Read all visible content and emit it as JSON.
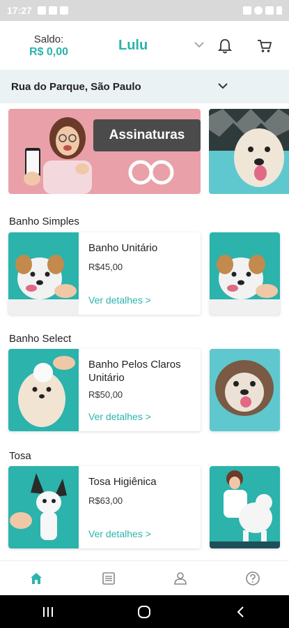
{
  "status_bar": {
    "time": "17:27",
    "icons_left": [
      "image-icon",
      "facebook-icon",
      "play-icon"
    ],
    "icons_right": [
      "mute-icon",
      "wifi-icon",
      "signal-icon",
      "battery-icon"
    ]
  },
  "header": {
    "balance_label": "Saldo:",
    "balance_value": "R$ 0,00",
    "pet_name": "Lulu",
    "icons": [
      "chevron-down-icon",
      "bell-icon",
      "cart-icon"
    ]
  },
  "address": {
    "text": "Rua do Parque, São Paulo",
    "icon": "chevron-down-icon"
  },
  "banner": {
    "tag": "Assinaturas",
    "icon": "infinity-icon"
  },
  "sections": [
    {
      "title": "Banho Simples",
      "product": {
        "name": "Banho Unitário",
        "price": "R$45,00",
        "details": "Ver detalhes >"
      }
    },
    {
      "title": "Banho Select",
      "product": {
        "name": "Banho Pelos Claros Unitário",
        "price": "R$50,00",
        "details": "Ver detalhes >"
      }
    },
    {
      "title": "Tosa",
      "product": {
        "name": "Tosa Higiênica",
        "price": "R$63,00",
        "details": "Ver detalhes >"
      }
    }
  ],
  "bottom_nav": {
    "items": [
      "home-icon",
      "orders-icon",
      "profile-icon",
      "help-icon"
    ],
    "active": "home-icon"
  },
  "system_nav": [
    "recents-icon",
    "home-circle-icon",
    "back-icon"
  ],
  "colors": {
    "accent": "#2bb3ac",
    "banner": "#e9a0a8",
    "address_bg": "#ebf2f4"
  }
}
